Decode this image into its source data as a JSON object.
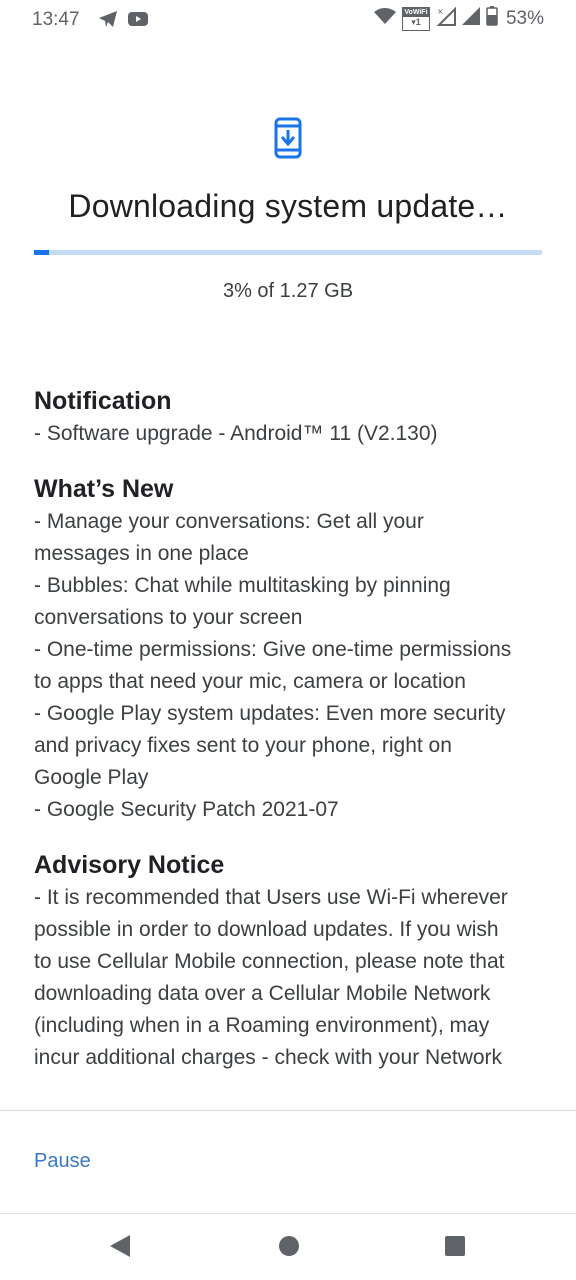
{
  "status_bar": {
    "time": "13:47",
    "left_icons": [
      "telegram-icon",
      "youtube-icon"
    ],
    "right_icons": [
      "wifi-icon",
      "vowifi-icon",
      "signal-no-data-icon",
      "signal-icon",
      "battery-icon"
    ],
    "vowifi_label": "VoWiFi",
    "vowifi_sub": "1",
    "battery_percent": "53%"
  },
  "header": {
    "icon": "system-update-download-icon",
    "title": "Downloading system update…"
  },
  "progress": {
    "percent": 3,
    "text": "3% of 1.27 GB",
    "fill_color": "#1a73e8",
    "track_color": "#c6dcf5"
  },
  "sections": [
    {
      "heading": "Notification",
      "lines": [
        "- Software upgrade - Android™ 11 (V2.130)"
      ]
    },
    {
      "heading": "What’s New",
      "lines": [
        "- Manage your conversations: Get all your",
        "messages in one place",
        "- Bubbles: Chat while multitasking by pinning",
        "conversations to your screen",
        "- One-time permissions: Give one-time permissions",
        "to apps that need your mic, camera or location",
        "- Google Play system updates: Even more security",
        "and privacy fixes sent to your phone, right on",
        "Google Play",
        "- Google Security Patch 2021-07"
      ]
    },
    {
      "heading": "Advisory Notice",
      "lines": [
        "- It is recommended that Users use Wi-Fi wherever",
        "possible in order to download updates. If you wish",
        "to use Cellular Mobile connection, please note that",
        "downloading data over a Cellular Mobile Network",
        "(including when in a Roaming environment), may",
        "incur additional charges - check with your Network"
      ]
    }
  ],
  "actions": {
    "pause_label": "Pause",
    "accent_color": "#3b78c4"
  },
  "nav_bar": {
    "buttons": [
      "back-icon",
      "home-icon",
      "recents-icon"
    ]
  }
}
